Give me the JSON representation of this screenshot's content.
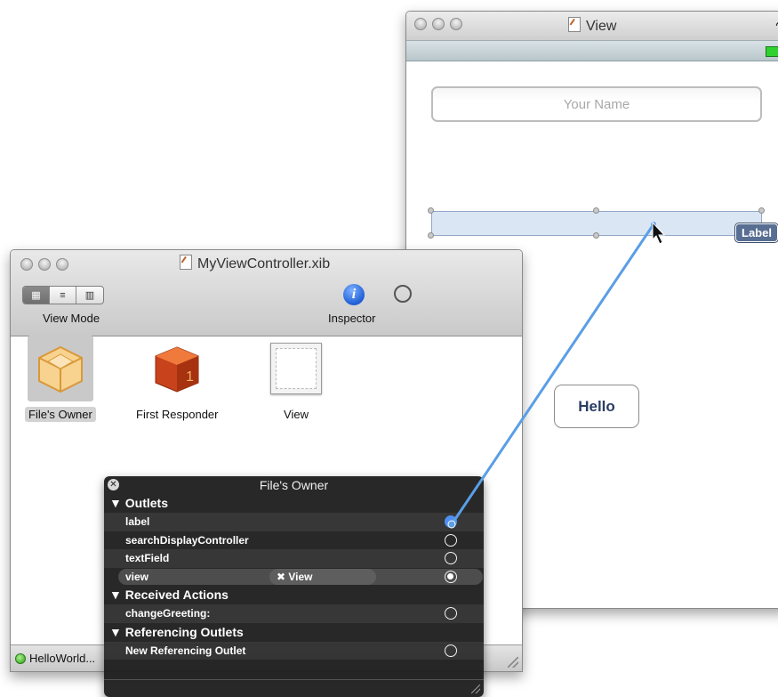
{
  "xib_window": {
    "title": "MyViewController.xib",
    "toolbar": {
      "view_mode_label": "View Mode",
      "inspector_label": "Inspector"
    },
    "items": [
      {
        "label": "File's Owner",
        "selected": true,
        "icon": "cube-icon"
      },
      {
        "label": "First Responder",
        "selected": false,
        "icon": "first-responder-icon"
      },
      {
        "label": "View",
        "selected": false,
        "icon": "view-icon"
      }
    ],
    "status_text": "HelloWorld..."
  },
  "view_window": {
    "title": "View",
    "text_field_placeholder": "Your Name",
    "label_badge": "Label",
    "button_label": "Hello"
  },
  "hud": {
    "title": "File's Owner",
    "sections": [
      {
        "label": "▼ Outlets",
        "rows": [
          {
            "label": "label",
            "connected": true
          },
          {
            "label": "searchDisplayController",
            "connected": false
          },
          {
            "label": "textField",
            "connected": false
          },
          {
            "label": "view",
            "connected": true,
            "connection_target": "✖ View"
          }
        ]
      },
      {
        "label": "▼ Received Actions",
        "rows": [
          {
            "label": "changeGreeting:",
            "connected": false
          }
        ]
      },
      {
        "label": "▼ Referencing Outlets",
        "rows": [
          {
            "label": "New Referencing Outlet",
            "connected": false
          }
        ]
      }
    ]
  },
  "colors": {
    "connection_line": "#5a9ee6",
    "label_fill": "#dbe6f4",
    "badge_fill": "#586e92"
  }
}
